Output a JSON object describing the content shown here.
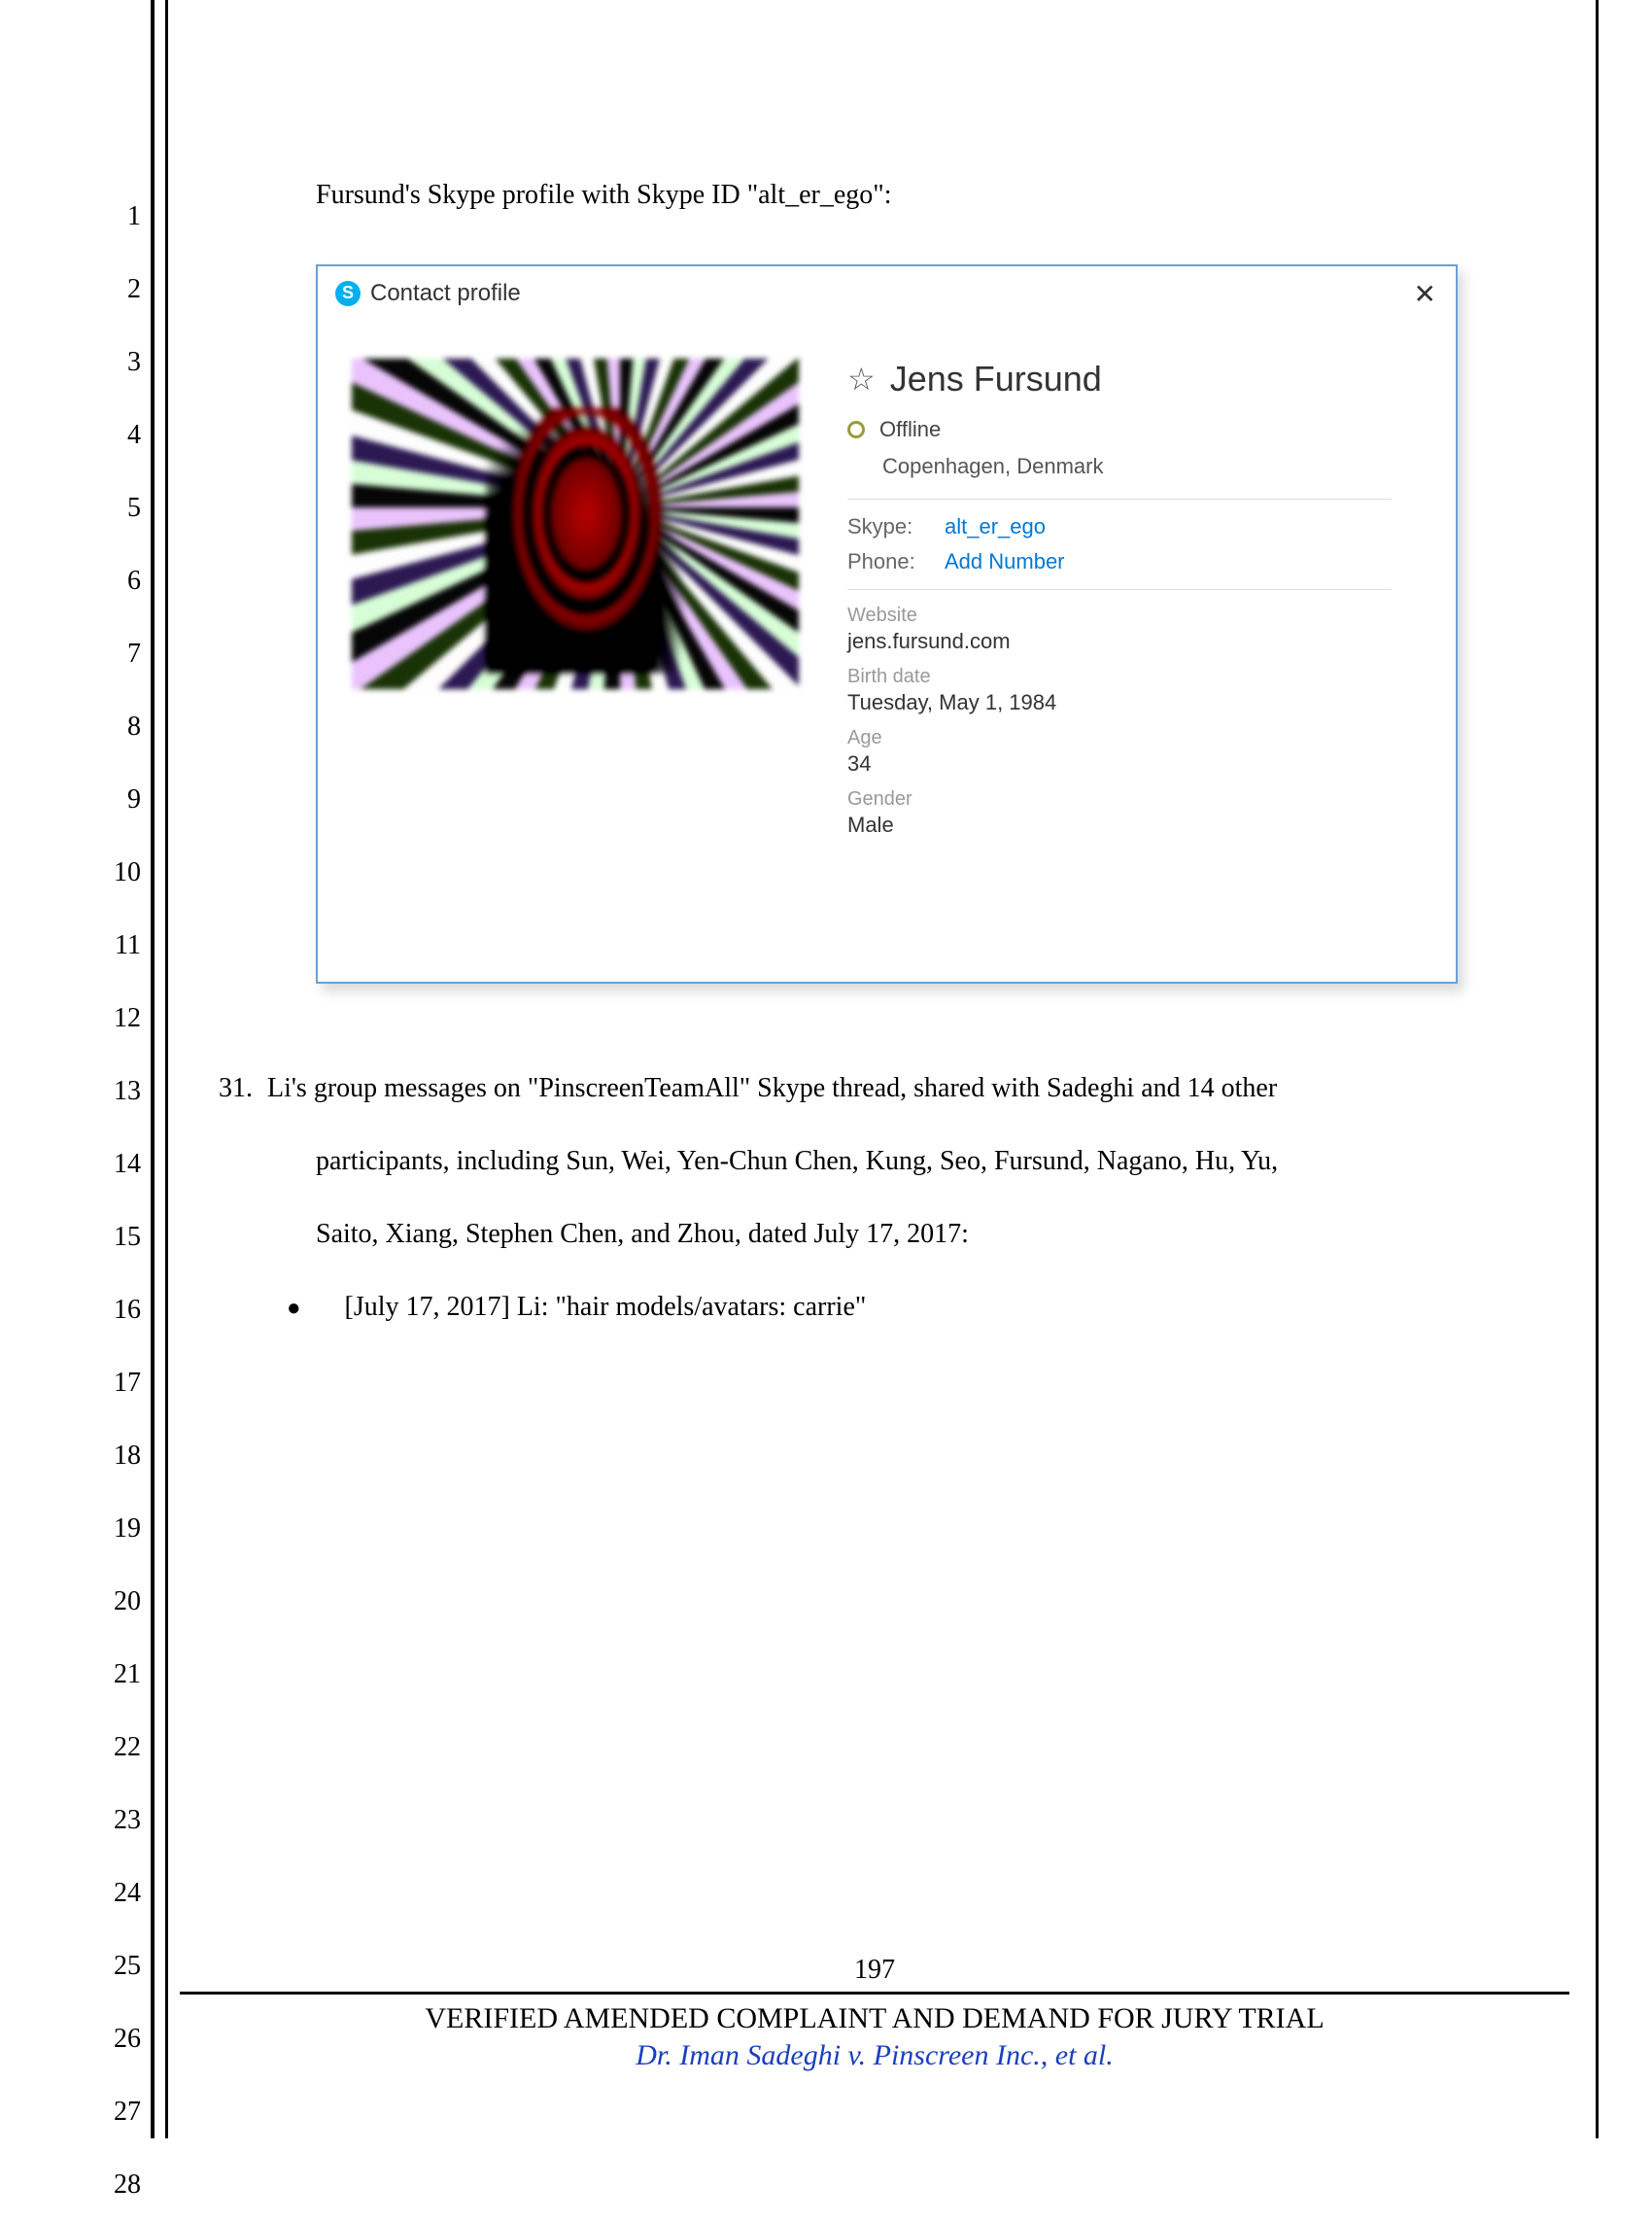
{
  "intro_line": "Fursund's Skype profile with Skype ID \"alt_er_ego\":",
  "skype": {
    "window_title": "Contact profile",
    "close_glyph": "✕",
    "star_glyph": "☆",
    "name": "Jens Fursund",
    "status": "Offline",
    "location": "Copenhagen, Denmark",
    "skype_label": "Skype:",
    "skype_value": "alt_er_ego",
    "phone_label": "Phone:",
    "phone_value": "Add Number",
    "website_label": "Website",
    "website_value": "jens.fursund.com",
    "birth_label": "Birth date",
    "birth_value": "Tuesday, May 1, 1984",
    "age_label": "Age",
    "age_value": "34",
    "gender_label": "Gender",
    "gender_value": "Male"
  },
  "paragraph31": {
    "number": "31.",
    "line1": "Li's group messages on \"PinscreenTeamAll\" Skype thread, shared with Sadeghi and 14 other",
    "line2": "participants, including Sun, Wei, Yen-Chun Chen, Kung, Seo, Fursund, Nagano, Hu, Yu,",
    "line3": "Saito, Xiang, Stephen Chen, and Zhou, dated July 17, 2017:",
    "bullet": "[July 17, 2017] Li: \"hair models/avatars: carrie\""
  },
  "footer": {
    "page_number": "197",
    "title": "VERIFIED AMENDED COMPLAINT AND DEMAND FOR JURY TRIAL",
    "case": "Dr. Iman Sadeghi v. Pinscreen Inc., et al."
  },
  "line_numbers": [
    "1",
    "2",
    "3",
    "4",
    "5",
    "6",
    "7",
    "8",
    "9",
    "10",
    "11",
    "12",
    "13",
    "14",
    "15",
    "16",
    "17",
    "18",
    "19",
    "20",
    "21",
    "22",
    "23",
    "24",
    "25",
    "26",
    "27",
    "28"
  ]
}
